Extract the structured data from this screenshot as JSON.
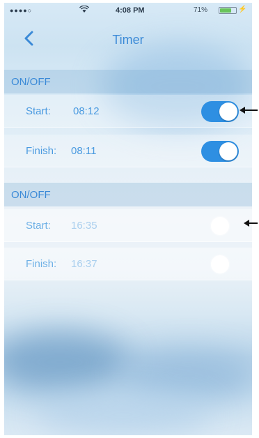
{
  "status_bar": {
    "signal_dots": "●●●●○",
    "wifi_icon": "wifi-icon",
    "time": "4:08 PM",
    "battery_percent": "71%",
    "battery_level": 0.71
  },
  "nav": {
    "back_icon": "chevron-left-icon",
    "back_glyph": "‹",
    "title": "Timer"
  },
  "timers": [
    {
      "header": "ON/OFF",
      "start_label": "Start:",
      "start_time": "08:12",
      "start_enabled": true,
      "finish_label": "Finish:",
      "finish_time": "08:11",
      "finish_enabled": true
    },
    {
      "header": "ON/OFF",
      "start_label": "Start:",
      "start_time": "16:35",
      "start_enabled": false,
      "finish_label": "Finish:",
      "finish_time": "16:37",
      "finish_enabled": false
    }
  ],
  "colors": {
    "accent": "#3b8ad7",
    "toggle_on": "#2e8fe2"
  }
}
